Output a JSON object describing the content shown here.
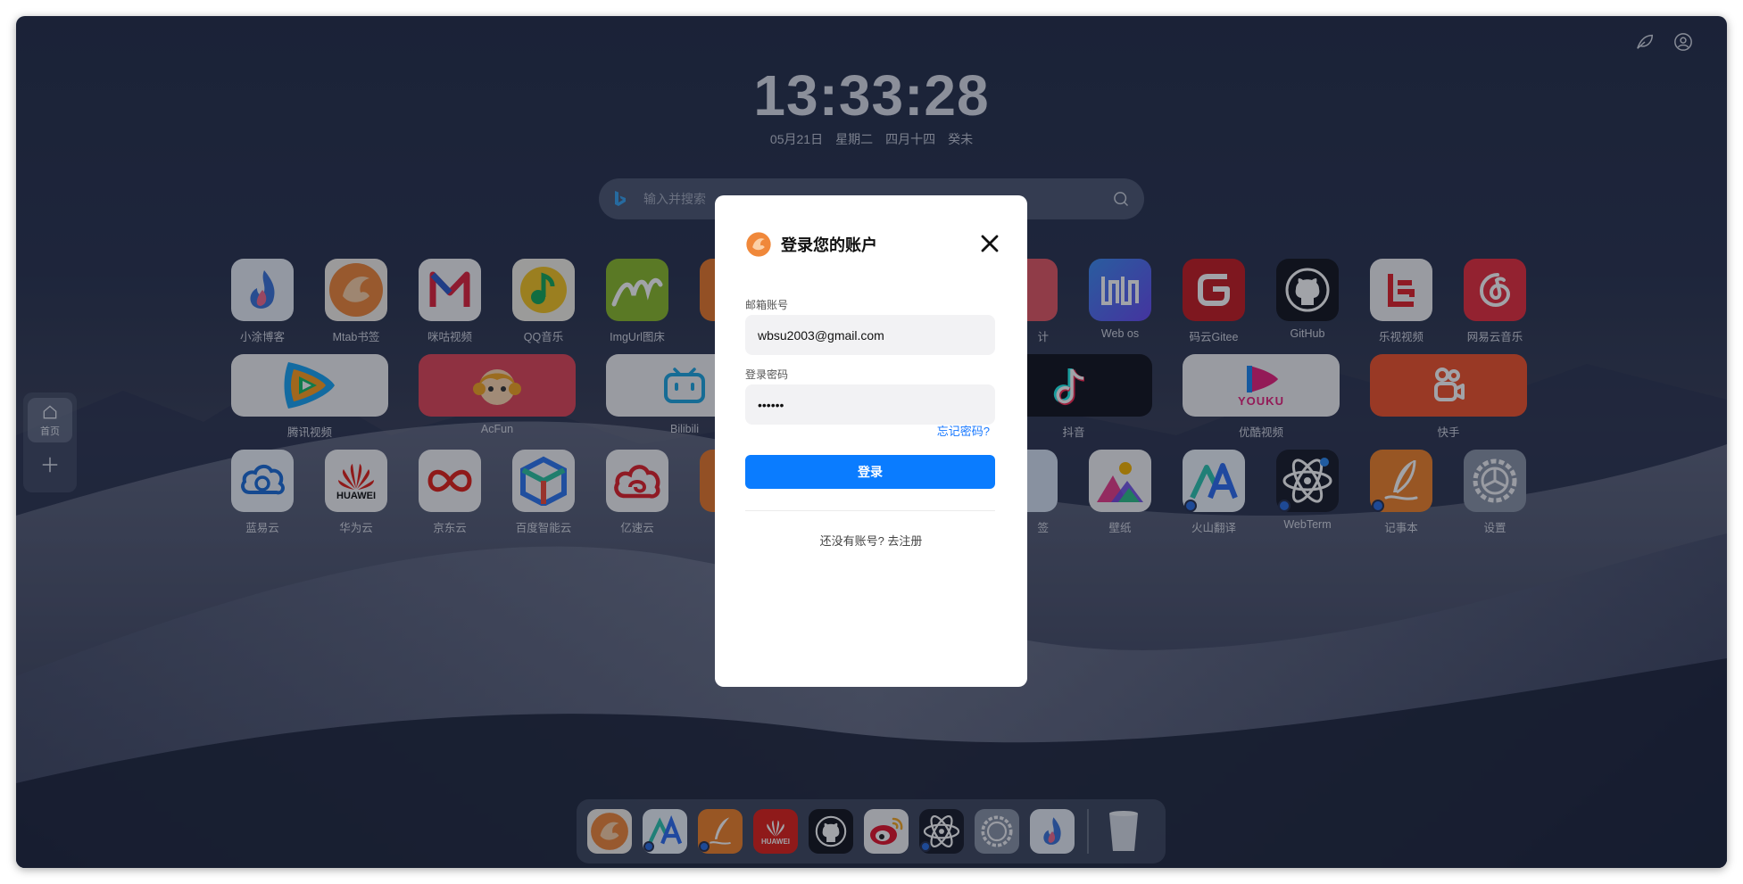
{
  "clock": {
    "time": "13:33:28",
    "date": "05月21日",
    "weekday": "星期二",
    "lunar": "四月十四",
    "ganzhi": "癸未"
  },
  "search": {
    "placeholder": "输入并搜索"
  },
  "sidebar": {
    "home_label": "首页"
  },
  "apps_row1": [
    {
      "label": "小涂博客",
      "icon": "flame-blog-icon"
    },
    {
      "label": "Mtab书签",
      "icon": "mtab-icon"
    },
    {
      "label": "咪咕视频",
      "icon": "migu-icon"
    },
    {
      "label": "QQ音乐",
      "icon": "qq-music-icon"
    },
    {
      "label": "ImgUrl图床",
      "icon": "imgurl-icon"
    },
    {
      "label": "Web os",
      "icon": "webos-icon"
    },
    {
      "label": "码云Gitee",
      "icon": "gitee-icon"
    },
    {
      "label": "GitHub",
      "icon": "github-icon"
    },
    {
      "label": "乐视视频",
      "icon": "letv-icon"
    },
    {
      "label": "网易云音乐",
      "icon": "netease-music-icon"
    }
  ],
  "apps_row2": [
    {
      "label": "腾讯视频",
      "icon": "tencent-video-icon"
    },
    {
      "label": "AcFun",
      "icon": "acfun-icon"
    },
    {
      "label": "Bilibili",
      "icon": "bilibili-icon"
    },
    {
      "label": "抖音",
      "icon": "douyin-icon"
    },
    {
      "label": "优酷视频",
      "icon": "youku-icon"
    },
    {
      "label": "快手",
      "icon": "kuaishou-icon"
    }
  ],
  "apps_row3": [
    {
      "label": "蓝易云",
      "icon": "lanyi-cloud-icon"
    },
    {
      "label": "华为云",
      "icon": "huawei-cloud-icon"
    },
    {
      "label": "京东云",
      "icon": "jd-cloud-icon"
    },
    {
      "label": "百度智能云",
      "icon": "baidu-cloud-icon"
    },
    {
      "label": "亿速云",
      "icon": "yisu-cloud-icon"
    },
    {
      "label": "壁纸",
      "icon": "wallpaper-icon"
    },
    {
      "label": "火山翻译",
      "icon": "volcano-translate-icon"
    },
    {
      "label": "WebTerm",
      "icon": "webterm-icon"
    },
    {
      "label": "记事本",
      "icon": "notepad-icon"
    },
    {
      "label": "设置",
      "icon": "settings-icon"
    }
  ],
  "partial_labels": {
    "row1_hidden": "计",
    "row3_hidden": "签"
  },
  "huawei_text": "HUAWEI",
  "youku_text": "YOUKU",
  "dock": [
    "mtab-icon",
    "translate-icon",
    "notepad-icon",
    "huawei-icon",
    "github-icon",
    "weibo-icon",
    "webterm-icon",
    "settings-icon",
    "flame-blog-icon",
    "trash-icon"
  ],
  "login": {
    "title": "登录您的账户",
    "email_label": "邮箱账号",
    "email_value": "wbsu2003@gmail.com",
    "password_label": "登录密码",
    "password_value": "••••••",
    "forgot": "忘记密码?",
    "submit": "登录",
    "no_account": "还没有账号?",
    "register": "去注册"
  }
}
